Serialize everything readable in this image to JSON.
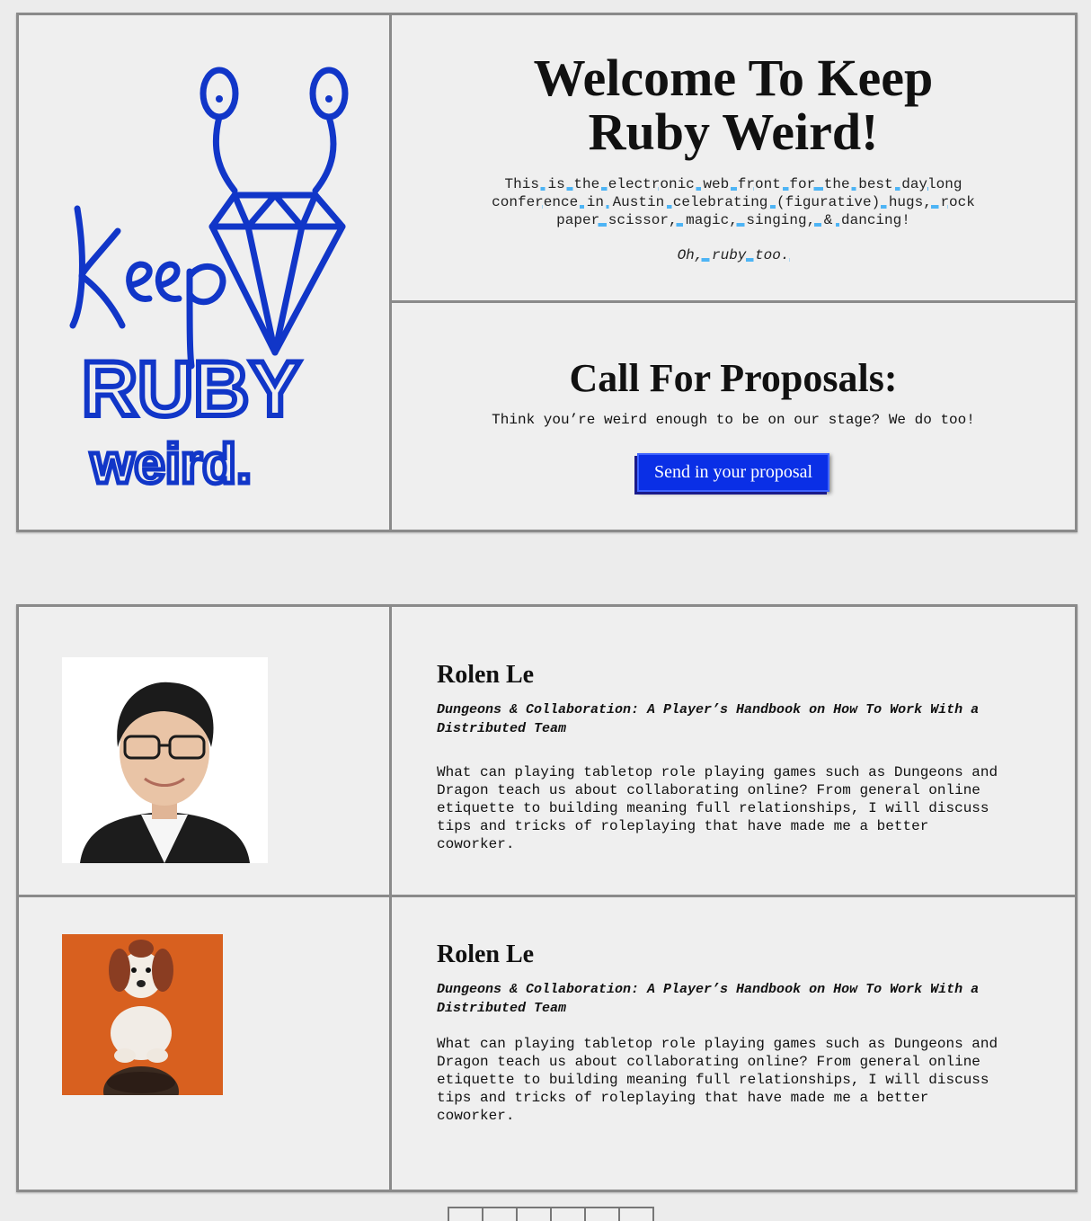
{
  "hero": {
    "logo_alt": "Keep RUBY weird.",
    "title": "Welcome To Keep Ruby Weird!",
    "description": "This is the electronic web front for the best daylong conference in Austin celebrating (figurative) hugs, rock paper scissor, magic, singing, & dancing!",
    "tagline": "Oh, ruby too."
  },
  "cfp": {
    "title": "Call For Proposals:",
    "text": "Think you’re weird enough to be on our stage? We do too!",
    "button_label": "Send in your proposal",
    "button_color": "#0a2fe6"
  },
  "talks": [
    {
      "speaker": "Rolen Le",
      "title": "Dungeons & Collaboration: A Player’s Handbook on How To Work With a Distributed Team",
      "description": "What can playing tabletop role playing games such as Dungeons and Dragon teach us about collaborating online? From general online etiquette to building meaning full relationships, I will discuss tips and tricks of roleplaying that have made me a better coworker."
    },
    {
      "speaker": "Rolen Le",
      "title": "Dungeons & Collaboration: A Player’s Handbook on How To Work With a Distributed Team",
      "description": "What can playing tabletop role playing games such as Dungeons and Dragon teach us about collaborating online? From general online etiquette to building meaning full relationships, I will discuss tips and tricks of roleplaying that have made me a better coworker."
    }
  ]
}
